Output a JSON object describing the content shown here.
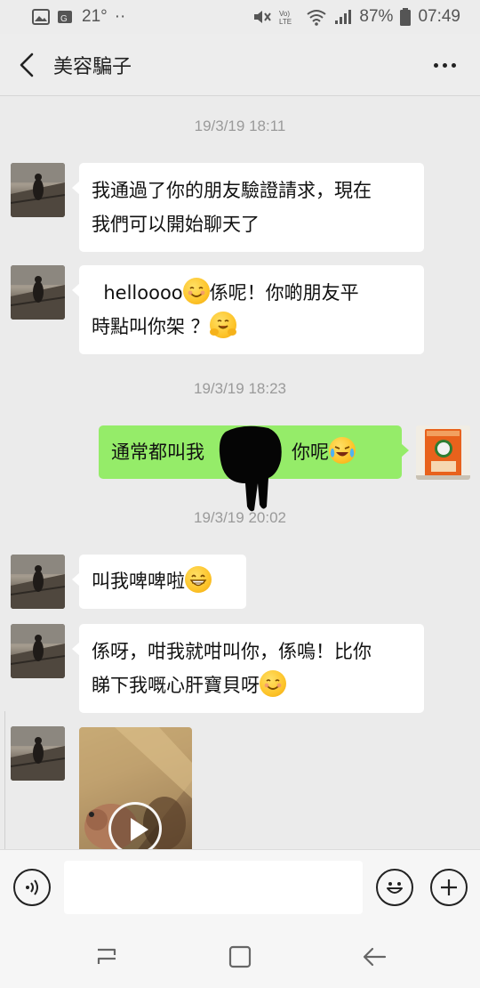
{
  "status_bar": {
    "temperature": "21°",
    "dots": "··",
    "battery_percent": "87%",
    "time": "07:49",
    "icons": [
      "gallery-icon",
      "location-icon",
      "mute-icon",
      "volte-icon",
      "wifi-icon",
      "signal-icon",
      "battery-icon"
    ]
  },
  "header": {
    "title": "美容騙子",
    "back_icon": "chevron-left-icon",
    "more_icon": "more-dots-icon"
  },
  "messages": [
    {
      "type": "timestamp",
      "text": "19/3/19 18:11"
    },
    {
      "type": "text",
      "side": "left",
      "lines": [
        "我通過了你的朋友驗證請求，現在",
        "我們可以開始聊天了"
      ]
    },
    {
      "type": "text",
      "side": "left",
      "text_a": "helloooo",
      "emoji_a": "smiling-face-emoji",
      "text_b": "係呢！你啲朋友平",
      "text_c": "時點叫你架 ？",
      "emoji_b": "hugging-face-emoji"
    },
    {
      "type": "timestamp",
      "text": "19/3/19 18:23"
    },
    {
      "type": "text",
      "side": "right",
      "text_a": "通常都叫我",
      "text_b": "呀，你呢",
      "emoji": "tears-of-joy-emoji",
      "redacted": true
    },
    {
      "type": "timestamp",
      "text": "19/3/19 20:02"
    },
    {
      "type": "text",
      "side": "left",
      "text": "叫我啤啤啦",
      "emoji": "grinning-face-emoji"
    },
    {
      "type": "text",
      "side": "left",
      "lines": [
        "係呀，咁我就咁叫你，係嗚！比你",
        "睇下我嘅心肝寶貝呀"
      ],
      "emoji": "smiling-face-emoji"
    },
    {
      "type": "video",
      "side": "left",
      "icon": "play-icon"
    }
  ],
  "input_bar": {
    "voice_icon": "voice-icon",
    "placeholder": "",
    "emoji_icon": "emoji-icon",
    "plus_icon": "plus-icon"
  },
  "nav_bar": {
    "icons": [
      "recent-apps-icon",
      "home-icon",
      "back-icon"
    ]
  },
  "colors": {
    "background": "#ebebeb",
    "sent_bubble": "#95ec69",
    "received_bubble": "#ffffff",
    "timestamp": "#9a9a9a"
  }
}
